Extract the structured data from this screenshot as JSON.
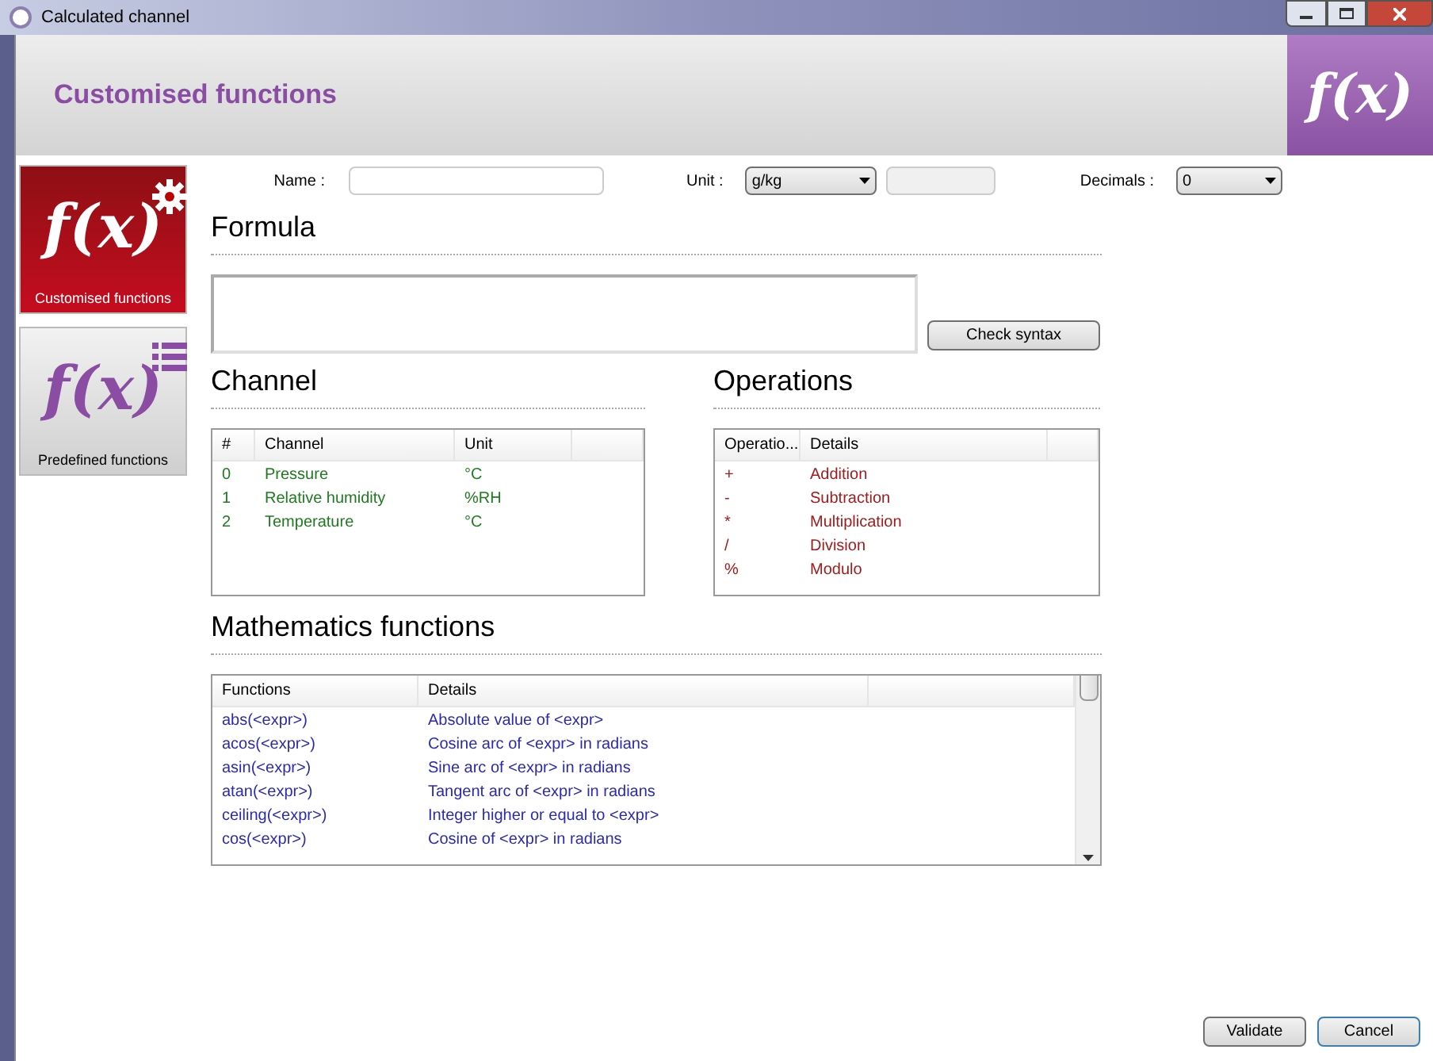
{
  "window": {
    "title": "Calculated channel"
  },
  "header": {
    "title": "Customised functions",
    "logo": "f(x)"
  },
  "sidebar": {
    "items": [
      {
        "label": "Customised functions",
        "kind": "custom",
        "selected": true,
        "logo": "f(x)"
      },
      {
        "label": "Predefined functions",
        "kind": "predefined",
        "selected": false,
        "logo": "f(x)"
      }
    ]
  },
  "form": {
    "name_label": "Name :",
    "unit_label": "Unit :",
    "unit_value": "g/kg",
    "decimals_label": "Decimals :",
    "decimals_value": "0"
  },
  "formula": {
    "heading": "Formula",
    "button": "Check syntax"
  },
  "channel": {
    "heading": "Channel",
    "columns": [
      "#",
      "Channel",
      "Unit"
    ],
    "rows": [
      [
        "0",
        "Pressure",
        "°C"
      ],
      [
        "1",
        "Relative humidity",
        "%RH"
      ],
      [
        "2",
        "Temperature",
        "°C"
      ]
    ]
  },
  "operations": {
    "heading": "Operations",
    "columns": [
      "Operatio...",
      "Details"
    ],
    "rows": [
      [
        "+",
        "Addition"
      ],
      [
        "-",
        "Subtraction"
      ],
      [
        "*",
        "Multiplication"
      ],
      [
        "/",
        "Division"
      ],
      [
        "%",
        "Modulo"
      ]
    ]
  },
  "math": {
    "heading": "Mathematics functions",
    "columns": [
      "Functions",
      "Details"
    ],
    "rows": [
      [
        "abs(<expr>)",
        "Absolute value of <expr>"
      ],
      [
        "acos(<expr>)",
        "Cosine arc of <expr> in radians"
      ],
      [
        "asin(<expr>)",
        "Sine arc of <expr> in radians"
      ],
      [
        "atan(<expr>)",
        "Tangent arc of <expr> in radians"
      ],
      [
        "ceiling(<expr>)",
        "Integer higher or equal to <expr>"
      ],
      [
        "cos(<expr>)",
        "Cosine of <expr> in radians"
      ]
    ]
  },
  "buttons": [
    "Validate",
    "Cancel"
  ]
}
